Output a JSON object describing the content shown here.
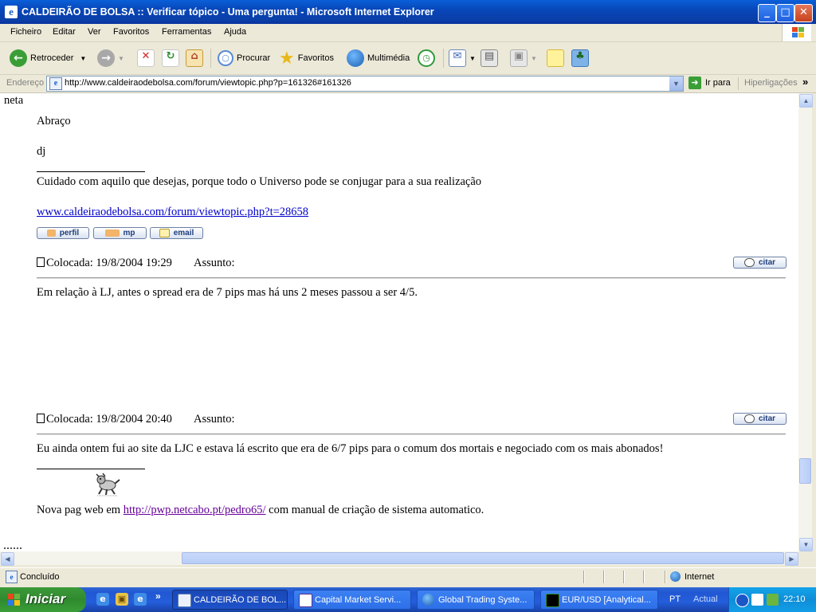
{
  "window": {
    "title": "CALDEIRÃO DE BOLSA :: Verificar tópico - Uma pergunta! - Microsoft Internet Explorer",
    "minimize": "_",
    "maximize": "□",
    "close": "✕"
  },
  "menu": {
    "items": [
      "Ficheiro",
      "Editar",
      "Ver",
      "Favoritos",
      "Ferramentas",
      "Ajuda"
    ]
  },
  "toolbar": {
    "back": "Retroceder",
    "search": "Procurar",
    "favorites": "Favoritos",
    "media": "Multimédia"
  },
  "address": {
    "label": "Endereço",
    "url": "http://www.caldeiraodebolsa.com/forum/viewtopic.php?p=161326#161326",
    "go": "Ir para",
    "links": "Hiperligações",
    "more": "»"
  },
  "content": {
    "left_fragment": "neta",
    "post1": {
      "greeting": "Abraço",
      "author": "dj",
      "signature": "Cuidado com aquilo que desejas, porque todo o Universo pode se conjugar para a sua realização",
      "link": "www.caldeiraodebolsa.com/forum/viewtopic.php?t=28658",
      "buttons": {
        "profile": "perfil",
        "pm": "mp",
        "email": "email"
      }
    },
    "post2": {
      "posted": "Colocada: 19/8/2004 19:29",
      "subject": "Assunto:",
      "quote": "citar",
      "body": "Em relação à LJ, antes o spread era de 7 pips mas há uns 2 meses passou a ser 4/5."
    },
    "post3": {
      "posted": "Colocada: 19/8/2004 20:40",
      "subject": "Assunto:",
      "quote": "citar",
      "body": "Eu ainda ontem fui ao site da LJC e estava lá escrito que era de 6/7 pips para o comum dos mortais e negociado com os mais abonados!",
      "sig_prefix": "Nova pag web em ",
      "sig_link": "http://pwp.netcabo.pt/pedro65/",
      "sig_suffix": " com manual de criação de sistema automatico."
    }
  },
  "status": {
    "text": "Concluído",
    "zone": "Internet"
  },
  "taskbar": {
    "start": "Iniciar",
    "chevron": "»",
    "tasks": [
      "CALDEIRÃO DE BOL...",
      "Capital Market Servi...",
      "Global Trading Syste...",
      "EUR/USD [Analytical..."
    ],
    "lang": "PT",
    "actual": "Actual",
    "clock": "22:10"
  },
  "colors": {
    "link": "#0000CC",
    "visited": "#660099",
    "titlebar": "#0A5FD8",
    "taskbar": "#245EDB",
    "start": "#3C9A3A"
  }
}
